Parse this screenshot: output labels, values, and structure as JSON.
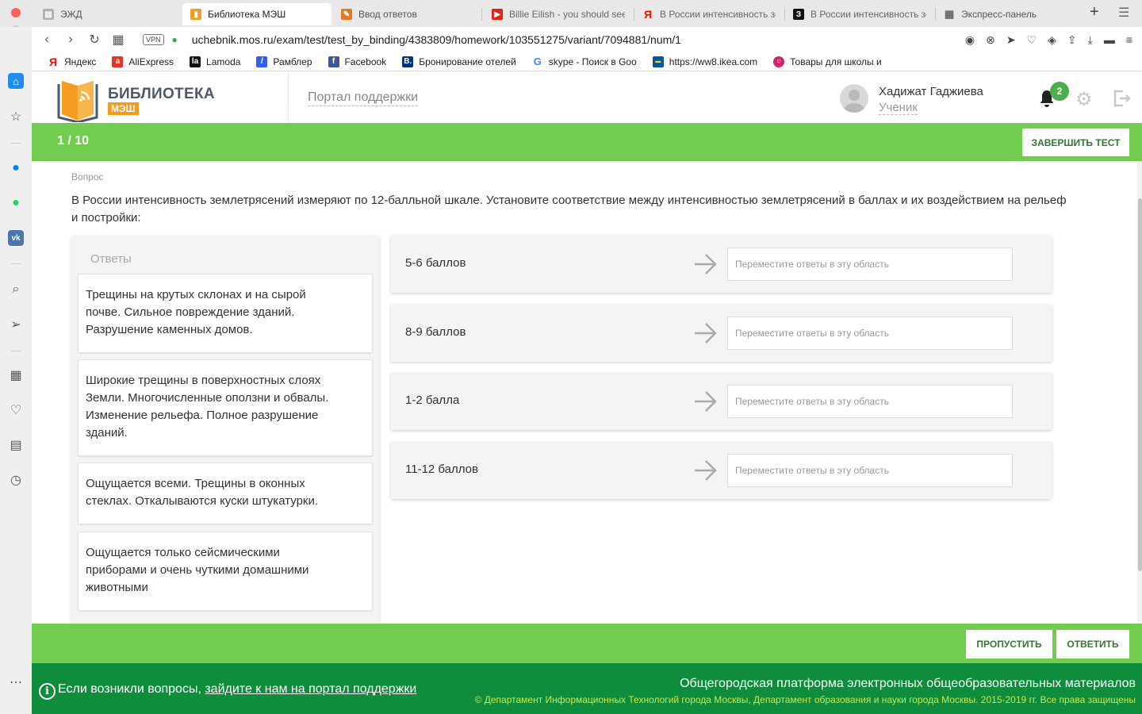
{
  "browser": {
    "tabs": [
      {
        "title": "ЭЖД",
        "icon": "document-icon",
        "active": false
      },
      {
        "title": "Библиотека МЭШ",
        "icon": "library-icon",
        "active": true
      },
      {
        "title": "Ввод ответов",
        "icon": "blog-icon",
        "active": false
      },
      {
        "title": "Billie Eilish - you should see me",
        "icon": "youtube-icon",
        "active": false
      },
      {
        "title": "В России интенсивность земл",
        "icon": "yandex-icon",
        "active": false
      },
      {
        "title": "В России интенсивность земл",
        "icon": "znanija-icon",
        "active": false
      },
      {
        "title": "Экспресс-панель",
        "icon": "grid-icon",
        "active": false
      }
    ],
    "vpn_label": "VPN",
    "url": "uchebnik.mos.ru/exam/test/test_by_binding/4383809/homework/103551275/variant/7094881/num/1",
    "bookmarks": [
      {
        "label": "Яндекс",
        "icon": "yandex-icon"
      },
      {
        "label": "AliExpress",
        "icon": "aliexpress-icon"
      },
      {
        "label": "Lamoda",
        "icon": "lamoda-icon"
      },
      {
        "label": "Рамблер",
        "icon": "rambler-icon"
      },
      {
        "label": "Facebook",
        "icon": "facebook-icon"
      },
      {
        "label": "Бронирование отелей",
        "icon": "booking-icon"
      },
      {
        "label": "skype - Поиск в Goo",
        "icon": "google-icon"
      },
      {
        "label": "https://ww8.ikea.com",
        "icon": "ikea-icon"
      },
      {
        "label": "Товары для школы и",
        "icon": "shop-icon"
      }
    ]
  },
  "header": {
    "logo_title": "БИБЛИОТЕКА",
    "logo_subtitle": "МЭШ",
    "support_link": "Портал поддержки",
    "user_name": "Хадижат Гаджиева",
    "user_role": "Ученик",
    "notifications_count": "2"
  },
  "test": {
    "counter": "1 / 10",
    "finish_label": "ЗАВЕРШИТЬ ТЕСТ",
    "question_label": "Вопрос",
    "question_text": "В России интенсивность землетрясений измеряют по 12-балльной шкале. Установите соответствие между интенсивностью землетрясений в баллах и их воздействием на рельеф и постройки:",
    "answers_title": "Ответы",
    "answers": [
      "Трещины на крутых склонах и на сырой почве. Сильное повреждение зданий. Разрушение каменных домов.",
      "Широкие трещины в поверхностных слоях Земли. Многочисленные оползни и обвалы. Изменение рельефа. Полное разрушение зданий.",
      "Ощущается всеми. Трещины в оконных стеклах. Откалываются куски штукатурки.",
      "Ощущается только сейсмическими приборами и очень чуткими домашними животными"
    ],
    "targets": [
      {
        "label": "5-6 баллов",
        "placeholder": "Переместите ответы в эту область"
      },
      {
        "label": "8-9 баллов",
        "placeholder": "Переместите ответы в эту область"
      },
      {
        "label": "1-2 балла",
        "placeholder": "Переместите ответы в эту область"
      },
      {
        "label": "11-12 баллов",
        "placeholder": "Переместите ответы в эту область"
      }
    ],
    "skip_label": "ПРОПУСТИТЬ",
    "answer_label": "ОТВЕТИТЬ"
  },
  "footer": {
    "question_prefix": "Если возникли вопросы,",
    "question_link": "зайдите к нам на портал поддержки",
    "platform_title": "Общегородская платформа электронных общеобразовательных материалов",
    "copyright": "© Департамент Информационных Технологий города Москвы, Департамент образования и науки города Москвы. 2015-2019 гг. Все права защищены"
  },
  "colors": {
    "green_bar": "#72cc4f",
    "footer_green": "#0f8c3c",
    "logo_orange": "#f39c1f",
    "badge_green": "#4cae4c"
  }
}
